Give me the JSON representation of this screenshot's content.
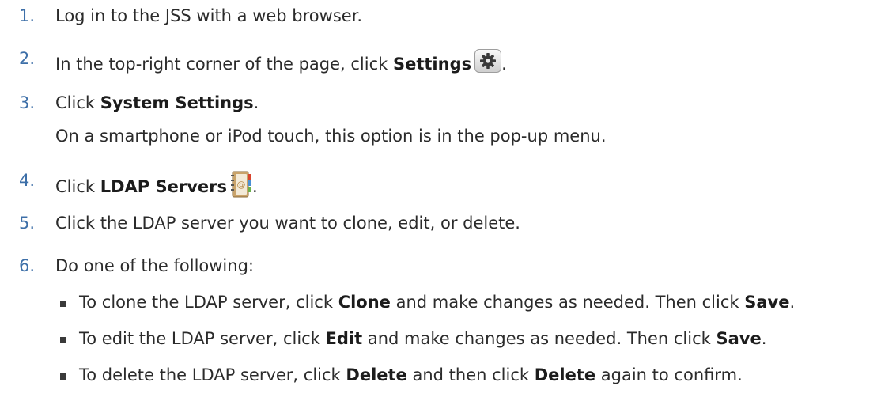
{
  "steps": [
    {
      "num": "1.",
      "text": "Log in to the JSS with a web browser."
    },
    {
      "num": "2.",
      "pre": "In the top-right corner of the page, click ",
      "bold": "Settings",
      "post": "."
    },
    {
      "num": "3.",
      "pre": "Click ",
      "bold": "System Settings",
      "post": ".",
      "sub": "On a smartphone or iPod touch, this option is in the pop-up menu."
    },
    {
      "num": "4.",
      "pre": "Click ",
      "bold": "LDAP Servers",
      "post": "."
    },
    {
      "num": "5.",
      "text": "Click the LDAP server you want to clone, edit, or delete."
    },
    {
      "num": "6.",
      "text": "Do one of the following:"
    }
  ],
  "bullets": [
    {
      "a": "To clone the LDAP server, click ",
      "b1": "Clone",
      "c": " and make changes as needed. Then click ",
      "b2": "Save",
      "d": "."
    },
    {
      "a": "To edit the LDAP server, click ",
      "b1": "Edit",
      "c": " and make changes as needed. Then click ",
      "b2": "Save",
      "d": "."
    },
    {
      "a": "To delete the LDAP server, click ",
      "b1": "Delete",
      "c": " and then click ",
      "b2": "Delete",
      "d": " again to confirm."
    }
  ],
  "icons": {
    "settings": "gear-icon",
    "ldap": "address-book-icon"
  },
  "colors": {
    "step_number": "#3d6fa8",
    "text": "#2b2b2b"
  }
}
